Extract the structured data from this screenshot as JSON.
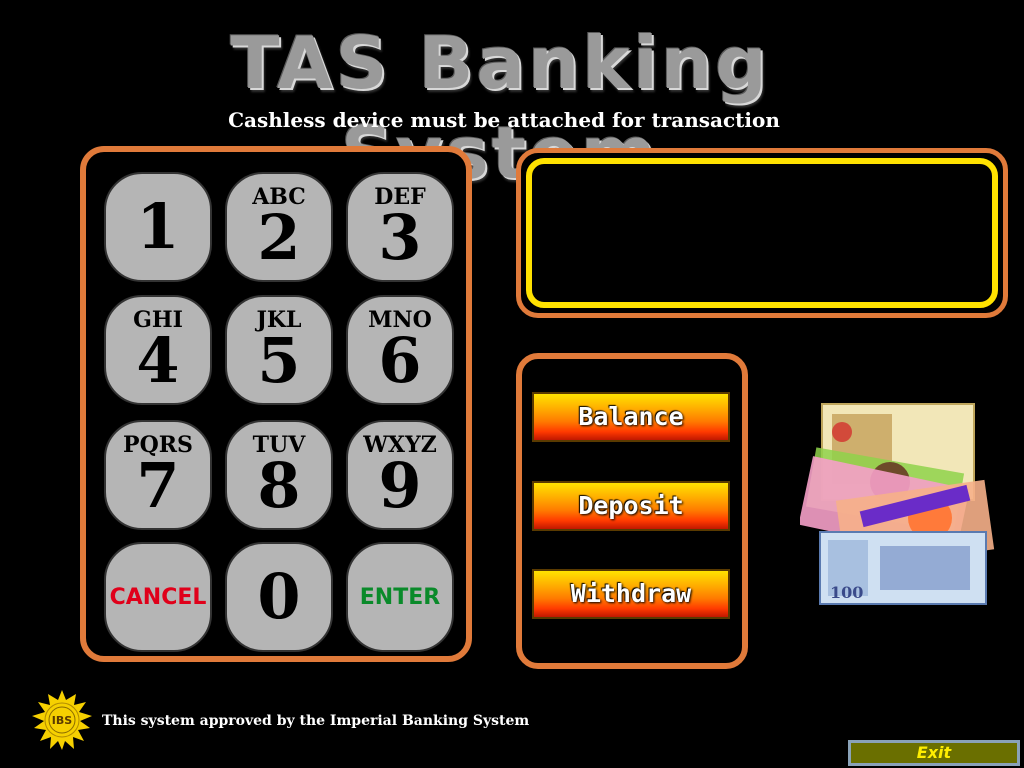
{
  "app": {
    "title": "TAS Banking System",
    "subtitle": "Cashless device must be attached for transaction"
  },
  "keypad": {
    "keys": [
      {
        "letters": "",
        "digit": "1"
      },
      {
        "letters": "ABC",
        "digit": "2"
      },
      {
        "letters": "DEF",
        "digit": "3"
      },
      {
        "letters": "GHI",
        "digit": "4"
      },
      {
        "letters": "JKL",
        "digit": "5"
      },
      {
        "letters": "MNO",
        "digit": "6"
      },
      {
        "letters": "PQRS",
        "digit": "7"
      },
      {
        "letters": "TUV",
        "digit": "8"
      },
      {
        "letters": "WXYZ",
        "digit": "9"
      }
    ],
    "cancel_label": "CANCEL",
    "zero_label": "0",
    "enter_label": "ENTER",
    "cancel_color": "#e0001a",
    "enter_color": "#0a8a2a",
    "border_color": "#e07a3a",
    "key_color": "#b5b5b5"
  },
  "display": {
    "text": "",
    "frame_color": "#ffe100"
  },
  "actions": {
    "balance_label": "Balance",
    "deposit_label": "Deposit",
    "withdraw_label": "Withdraw"
  },
  "footer": {
    "seal_text": "IBS",
    "approval_text": "This system approved by the Imperial Banking System",
    "exit_label": "Exit"
  },
  "icons": {
    "money": "banknotes-image",
    "seal": "ibs-seal-icon"
  }
}
